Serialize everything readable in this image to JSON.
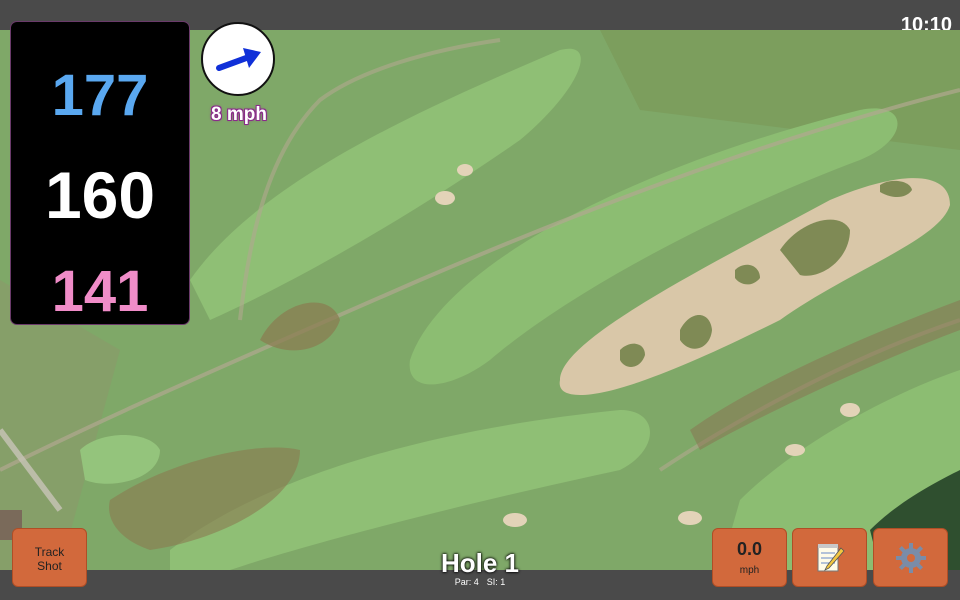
{
  "status": {
    "time": "10:10"
  },
  "distances": {
    "back": "177",
    "middle": "160",
    "front": "141"
  },
  "wind": {
    "speed_label": "8 mph",
    "direction_icon": "arrow-icon"
  },
  "hole": {
    "title": "Hole 1",
    "par": "Par: 4",
    "si": "SI: 1"
  },
  "buttons": {
    "track_shot": {
      "line1": "Track",
      "line2": "Shot"
    },
    "wind_speed": {
      "value": "0.0",
      "unit": "mph"
    },
    "notes_icon": "notepad-icon",
    "settings_icon": "gear-icon"
  },
  "colors": {
    "back": "#5aa8f0",
    "middle": "#ffffff",
    "front": "#f08cc8",
    "button": "#d2693c"
  }
}
